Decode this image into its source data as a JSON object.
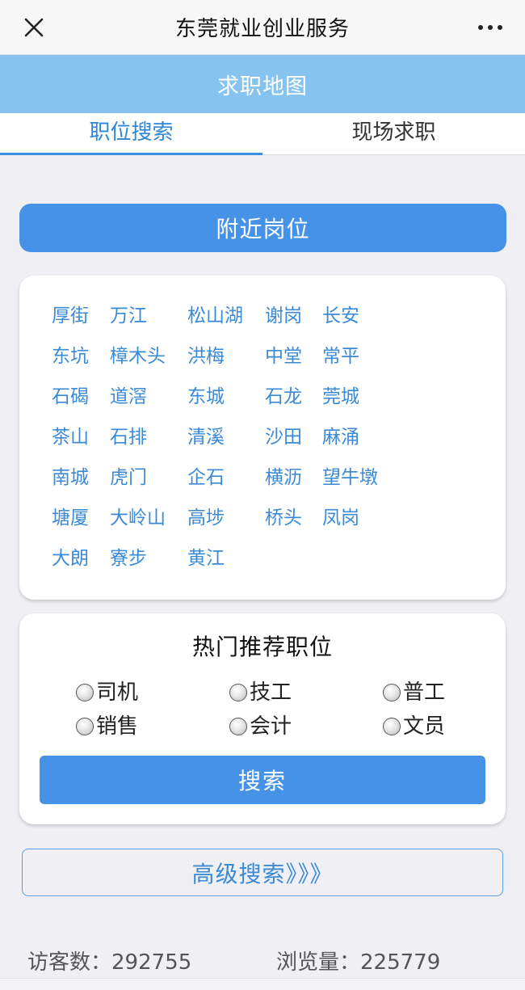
{
  "topbar": {
    "title": "东莞就业创业服务",
    "close_icon": "close-icon",
    "more_icon": "more-icon"
  },
  "banner": {
    "title": "求职地图"
  },
  "tabs": [
    {
      "label": "职位搜索",
      "active": true
    },
    {
      "label": "现场求职",
      "active": false
    }
  ],
  "nearby": {
    "label": "附近岗位"
  },
  "districts": [
    [
      "厚街",
      "万江",
      "松山湖",
      "谢岗",
      "长安"
    ],
    [
      "东坑",
      "樟木头",
      "洪梅",
      "中堂",
      "常平"
    ],
    [
      "石碣",
      "道滘",
      "东城",
      "石龙",
      "莞城"
    ],
    [
      "茶山",
      "石排",
      "清溪",
      "沙田",
      "麻涌"
    ],
    [
      "南城",
      "虎门",
      "企石",
      "横沥",
      "望牛墩"
    ],
    [
      "塘厦",
      "大岭山",
      "高埗",
      "桥头",
      "凤岗"
    ],
    [
      "大朗",
      "寮步",
      "黄江"
    ]
  ],
  "hot": {
    "title": "热门推荐职位",
    "options": [
      "司机",
      "技工",
      "普工",
      "销售",
      "会计",
      "文员"
    ],
    "search_label": "搜索"
  },
  "advanced": {
    "label": "高级搜索》》》"
  },
  "footer": {
    "visitors_label": "访客数：",
    "visitors_value": "292755",
    "views_label": "浏览量：",
    "views_value": "225779"
  },
  "colors": {
    "accent": "#4592e6",
    "banner": "#86c3ef",
    "link": "#3a8ad6"
  }
}
